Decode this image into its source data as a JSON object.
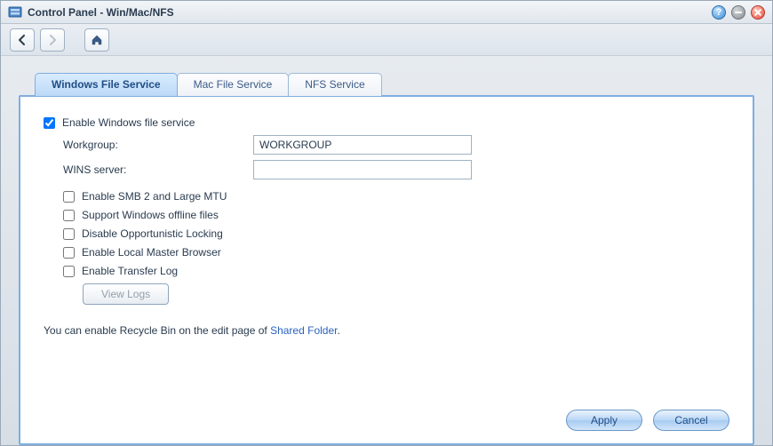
{
  "window": {
    "title": "Control Panel - Win/Mac/NFS"
  },
  "tabs": {
    "windows": "Windows File Service",
    "mac": "Mac File Service",
    "nfs": "NFS Service"
  },
  "form": {
    "enable_label": "Enable Windows file service",
    "enable_checked": true,
    "workgroup_label": "Workgroup:",
    "workgroup_value": "WORKGROUP",
    "wins_label": "WINS server:",
    "wins_value": "",
    "options": {
      "smb2": {
        "label": "Enable SMB 2 and Large MTU",
        "checked": false
      },
      "offline": {
        "label": "Support Windows offline files",
        "checked": false
      },
      "oplock": {
        "label": "Disable Opportunistic Locking",
        "checked": false
      },
      "master": {
        "label": "Enable Local Master Browser",
        "checked": false
      },
      "transferlog": {
        "label": "Enable Transfer Log",
        "checked": false
      }
    },
    "view_logs": "View Logs",
    "hint_prefix": "You can enable Recycle Bin on the edit page of ",
    "hint_link": "Shared Folder",
    "hint_suffix": "."
  },
  "footer": {
    "apply": "Apply",
    "cancel": "Cancel"
  }
}
